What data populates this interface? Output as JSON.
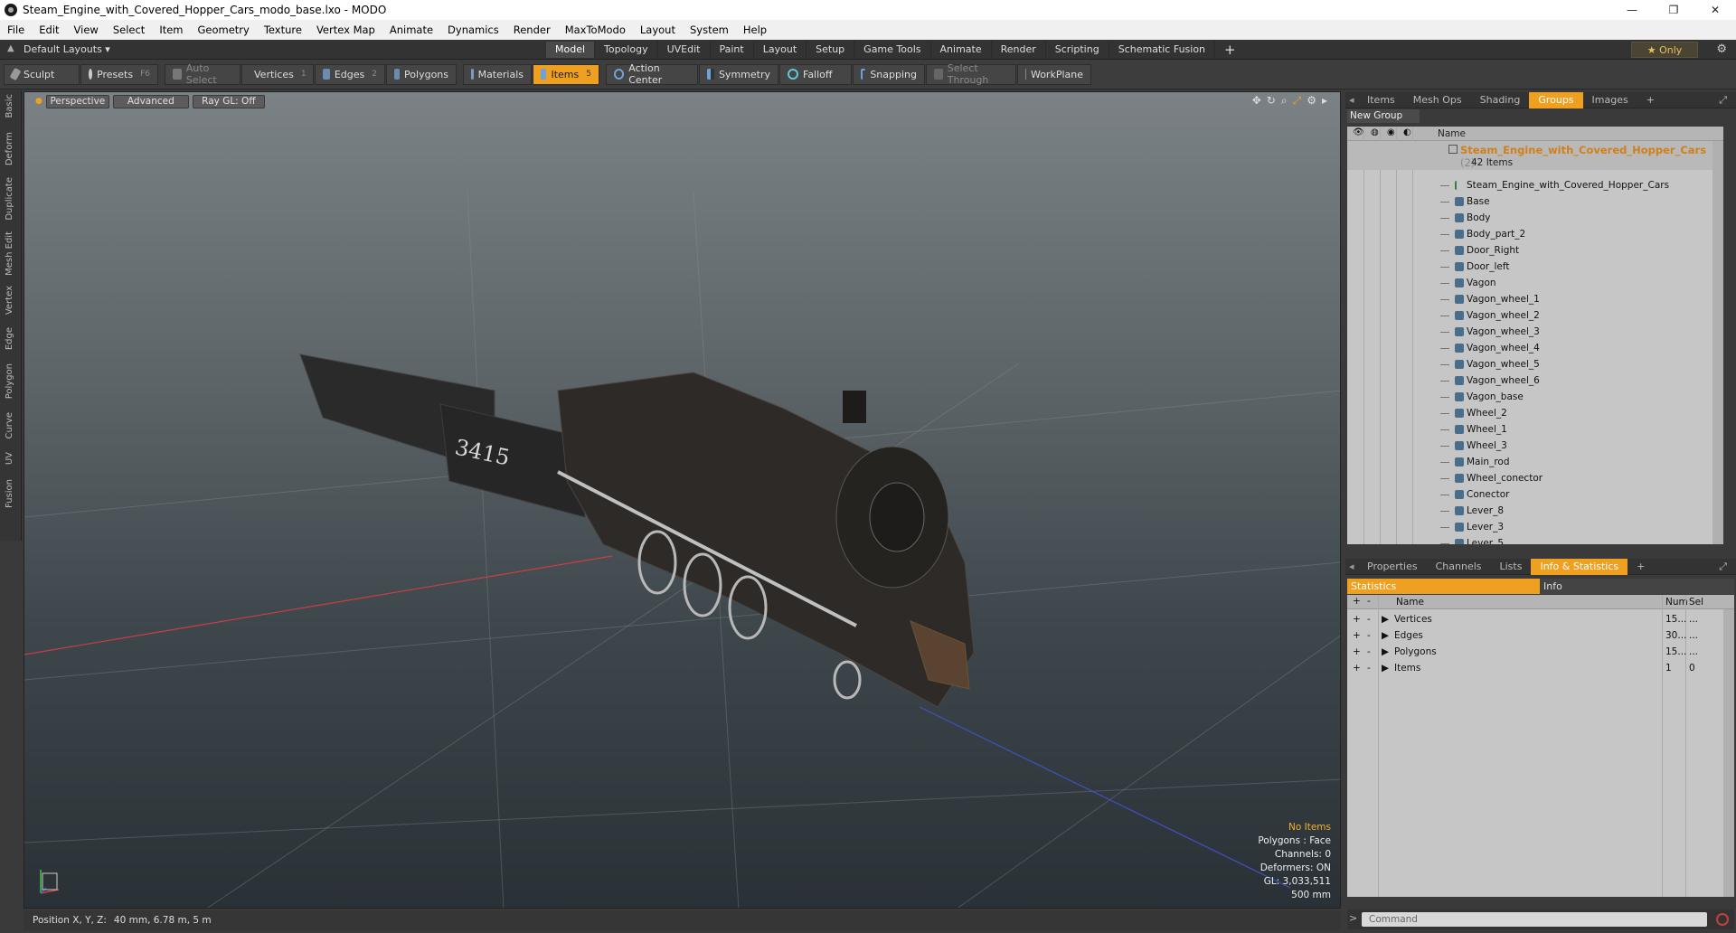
{
  "window": {
    "title": "Steam_Engine_with_Covered_Hopper_Cars_modo_base.lxo - MODO",
    "minimize": "—",
    "maximize": "❐",
    "close": "✕"
  },
  "menu": [
    "File",
    "Edit",
    "View",
    "Select",
    "Item",
    "Geometry",
    "Texture",
    "Vertex Map",
    "Animate",
    "Dynamics",
    "Render",
    "MaxToModo",
    "Layout",
    "System",
    "Help"
  ],
  "layoutbar": {
    "layouts_label": "Default Layouts ▾",
    "tabs": [
      "Model",
      "Topology",
      "UVEdit",
      "Paint",
      "Layout",
      "Setup",
      "Game Tools",
      "Animate",
      "Render",
      "Scripting",
      "Schematic Fusion"
    ],
    "active_tab": "Model",
    "only_label": "★  Only"
  },
  "toolbar": {
    "sculpt": "Sculpt",
    "presets": "Presets",
    "presets_key": "F6",
    "auto_select": "Auto Select",
    "vertices": "Vertices",
    "vertices_key": "1",
    "edges": "Edges",
    "edges_key": "2",
    "polygons": "Polygons",
    "materials": "Materials",
    "items": "Items",
    "items_key": "5",
    "action_center": "Action Center",
    "symmetry": "Symmetry",
    "falloff": "Falloff",
    "snapping": "Snapping",
    "select_through": "Select Through",
    "workplane": "WorkPlane"
  },
  "left_tabs": [
    "Basic",
    "Deform",
    "Duplicate",
    "Mesh Edit",
    "Vertex",
    "Edge",
    "Polygon",
    "Curve",
    "UV",
    "Fusion"
  ],
  "viewport": {
    "perspective": "Perspective",
    "advanced": "Advanced",
    "raygl": "Ray GL: Off",
    "stats": {
      "no_items": "No Items",
      "polygons": "Polygons : Face",
      "channels": "Channels: 0",
      "deformers": "Deformers: ON",
      "gl": "GL: 3,033,511",
      "scale": "500 mm"
    },
    "number_on_tender": "3415"
  },
  "status": {
    "position_label": "Position X, Y, Z:",
    "position_value": "40 mm, 6.78 m, 5 m"
  },
  "top_panel": {
    "tabs": [
      "Items",
      "Mesh Ops",
      "Shading",
      "Groups",
      "Images"
    ],
    "active_tab": "Groups",
    "new_group": "New Group",
    "name_header": "Name",
    "group_name": "Steam_Engine_with_Covered_Hopper_Cars",
    "group_count": "(2)",
    "items_count": "42 Items",
    "items": [
      "Steam_Engine_with_Covered_Hopper_Cars",
      "Base",
      "Body",
      "Body_part_2",
      "Door_Right",
      "Door_left",
      "Vagon",
      "Vagon_wheel_1",
      "Vagon_wheel_2",
      "Vagon_wheel_3",
      "Vagon_wheel_4",
      "Vagon_wheel_5",
      "Vagon_wheel_6",
      "Vagon_base",
      "Wheel_2",
      "Wheel_1",
      "Wheel_3",
      "Main_rod",
      "Wheel_conector",
      "Conector",
      "Lever_8",
      "Lever_3",
      "Lever_5"
    ]
  },
  "bottom_panel": {
    "tabs": [
      "Properties",
      "Channels",
      "Lists",
      "Info & Statistics"
    ],
    "active_tab": "Info & Statistics",
    "statistics": "Statistics",
    "info": "Info",
    "headers": {
      "name": "Name",
      "num": "Num",
      "sel": "Sel"
    },
    "rows": [
      {
        "name": "Vertices",
        "num": "15...",
        "sel": "..."
      },
      {
        "name": "Edges",
        "num": "30...",
        "sel": "..."
      },
      {
        "name": "Polygons",
        "num": "15...",
        "sel": "..."
      },
      {
        "name": "Items",
        "num": "1",
        "sel": "0"
      }
    ],
    "command_placeholder": "Command"
  },
  "colors": {
    "accent": "#f0a020",
    "group_title": "#d0801a"
  }
}
